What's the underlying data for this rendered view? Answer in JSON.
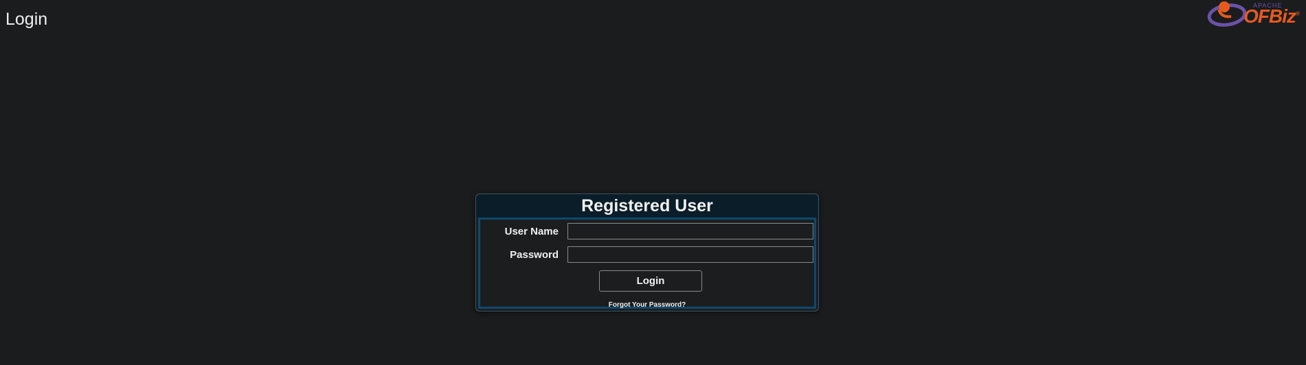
{
  "header": {
    "title": "Login"
  },
  "logo": {
    "top_text": "APACHE",
    "main_text": "OFBiz",
    "registered_mark": "®",
    "colors": {
      "orange": "#e55b1d",
      "purple": "#6b52a8"
    }
  },
  "login_box": {
    "title": "Registered User",
    "username": {
      "label": "User Name",
      "value": ""
    },
    "password": {
      "label": "Password",
      "value": ""
    },
    "login_button_label": "Login",
    "forgot_password_label": "Forgot Your Password?",
    "colors": {
      "header_bg": "#0a1d29",
      "border_accent": "#0c4a6e"
    }
  }
}
